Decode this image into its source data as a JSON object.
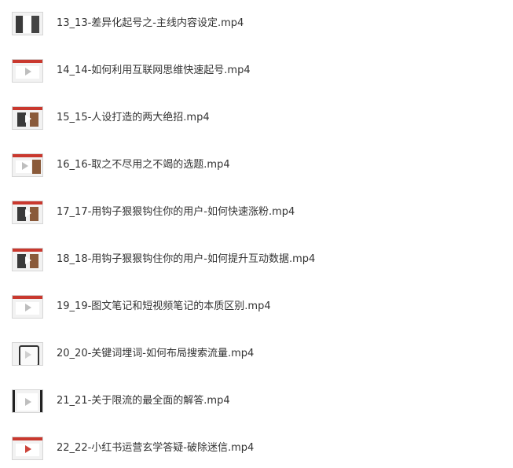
{
  "files": [
    {
      "name": "13_13-差异化起号之-主线内容设定.mp4",
      "thumb": "video-thumbnail"
    },
    {
      "name": "14_14-如何利用互联网思维快速起号.mp4",
      "thumb": "video-thumbnail"
    },
    {
      "name": "15_15-人设打造的两大绝招.mp4",
      "thumb": "video-thumbnail"
    },
    {
      "name": "16_16-取之不尽用之不竭的选题.mp4",
      "thumb": "video-thumbnail"
    },
    {
      "name": "17_17-用钩子狠狠钩住你的用户-如何快速涨粉.mp4",
      "thumb": "video-thumbnail"
    },
    {
      "name": "18_18-用钩子狠狠钩住你的用户-如何提升互动数据.mp4",
      "thumb": "video-thumbnail"
    },
    {
      "name": "19_19-图文笔记和短视频笔记的本质区别.mp4",
      "thumb": "video-thumbnail"
    },
    {
      "name": "20_20-关键词埋词-如何布局搜索流量.mp4",
      "thumb": "video-thumbnail"
    },
    {
      "name": "21_21-关于限流的最全面的解答.mp4",
      "thumb": "video-thumbnail"
    },
    {
      "name": "22_22-小红书运营玄学答疑-破除迷信.mp4",
      "thumb": "video-thumbnail"
    }
  ],
  "colors": {
    "text": "#333333",
    "thumb_accent": "#c9382e"
  }
}
